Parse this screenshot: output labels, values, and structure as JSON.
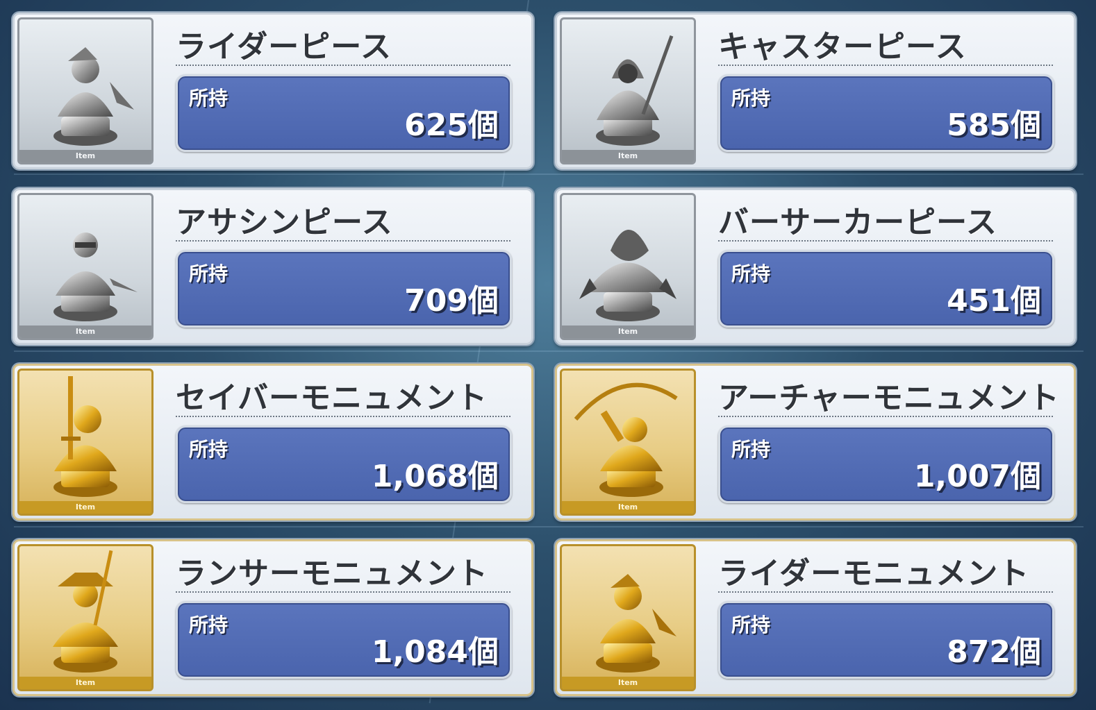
{
  "colors": {
    "count_box": "#4a64ad",
    "silver_frame": "#8f959c",
    "gold_frame": "#b8902a"
  },
  "items": [
    {
      "name": "ライダーピース",
      "held_label": "所持",
      "count": "625個",
      "tag": "Item",
      "tier": "silver",
      "icon": "rider-piece-bust-icon"
    },
    {
      "name": "キャスターピース",
      "held_label": "所持",
      "count": "585個",
      "tag": "Item",
      "tier": "silver",
      "icon": "caster-piece-bust-icon"
    },
    {
      "name": "アサシンピース",
      "held_label": "所持",
      "count": "709個",
      "tag": "Item",
      "tier": "silver",
      "icon": "assassin-piece-bust-icon"
    },
    {
      "name": "バーサーカーピース",
      "held_label": "所持",
      "count": "451個",
      "tag": "Item",
      "tier": "silver",
      "icon": "berserker-piece-bust-icon"
    },
    {
      "name": "セイバーモニュメント",
      "held_label": "所持",
      "count": "1,068個",
      "tag": "Item",
      "tier": "gold",
      "icon": "saber-monument-bust-icon"
    },
    {
      "name": "アーチャーモニュメント",
      "held_label": "所持",
      "count": "1,007個",
      "tag": "Item",
      "tier": "gold",
      "icon": "archer-monument-bust-icon"
    },
    {
      "name": "ランサーモニュメント",
      "held_label": "所持",
      "count": "1,084個",
      "tag": "Item",
      "tier": "gold",
      "icon": "lancer-monument-bust-icon"
    },
    {
      "name": "ライダーモニュメント",
      "held_label": "所持",
      "count": "872個",
      "tag": "Item",
      "tier": "gold",
      "icon": "rider-monument-bust-icon"
    }
  ]
}
